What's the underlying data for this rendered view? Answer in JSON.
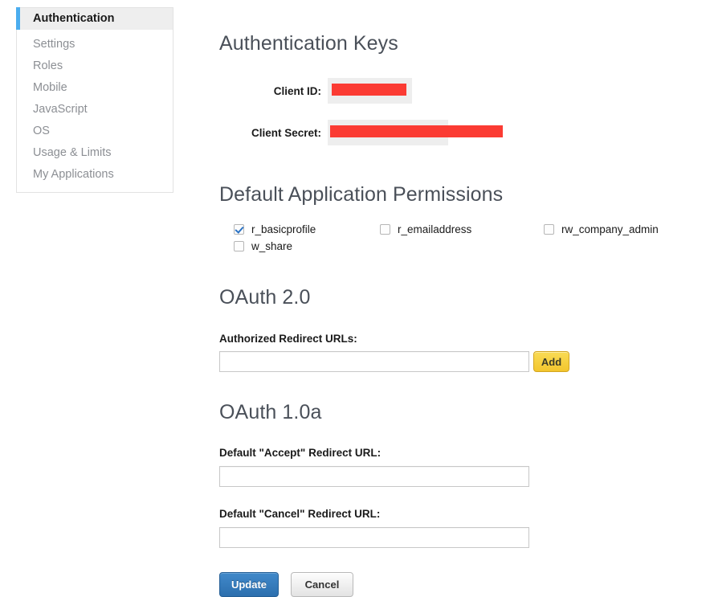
{
  "sidebar": {
    "items": [
      {
        "label": "Authentication",
        "active": true
      },
      {
        "label": "Settings",
        "active": false
      },
      {
        "label": "Roles",
        "active": false
      },
      {
        "label": "Mobile",
        "active": false
      },
      {
        "label": "JavaScript",
        "active": false
      },
      {
        "label": "OS",
        "active": false
      },
      {
        "label": "Usage & Limits",
        "active": false
      },
      {
        "label": "My Applications",
        "active": false
      }
    ],
    "accent_color": "#4badef",
    "active_background": "#eeeeee"
  },
  "auth_keys": {
    "heading": "Authentication Keys",
    "client_id": {
      "label": "Client ID:",
      "value": "",
      "redacted": true
    },
    "client_secret": {
      "label": "Client Secret:",
      "value": "",
      "redacted": true
    },
    "redaction_color": "#fb3b33",
    "value_background": "#eeeeee"
  },
  "permissions": {
    "heading": "Default Application Permissions",
    "items": [
      {
        "label": "r_basicprofile",
        "checked": true
      },
      {
        "label": "w_share",
        "checked": false
      },
      {
        "label": "r_emailaddress",
        "checked": false
      },
      {
        "label": "rw_company_admin",
        "checked": false
      }
    ],
    "check_color": "#2a72c4"
  },
  "oauth2": {
    "heading": "OAuth 2.0",
    "redirect_urls_label": "Authorized Redirect URLs:",
    "redirect_urls_value": "",
    "redirect_urls_placeholder": "",
    "add_label": "Add",
    "add_color": "#f3c62e"
  },
  "oauth1": {
    "heading": "OAuth 1.0a",
    "accept_label": "Default \"Accept\" Redirect URL:",
    "accept_value": "",
    "accept_placeholder": "",
    "cancel_label": "Default \"Cancel\" Redirect URL:",
    "cancel_value": "",
    "cancel_placeholder": ""
  },
  "actions": {
    "update_label": "Update",
    "update_color": "#2c6fae",
    "cancel_label": "Cancel"
  }
}
